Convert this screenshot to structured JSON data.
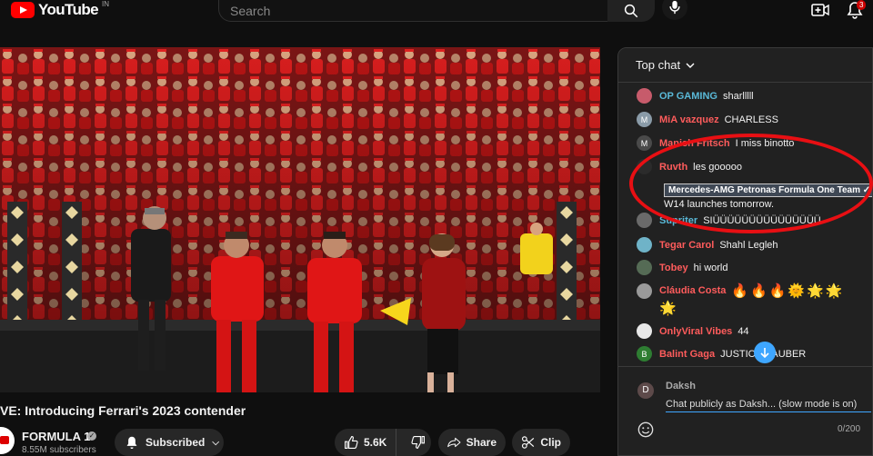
{
  "header": {
    "logo_text": "YouTube",
    "country_code": "IN",
    "search_placeholder": "Search",
    "notification_count": "3"
  },
  "video": {
    "title": "VE: Introducing Ferrari's 2023 contender"
  },
  "channel": {
    "name": "FORMULA 1",
    "subscribers": "8.55M subscribers",
    "subscribe_label": "Subscribed"
  },
  "actions": {
    "likes": "5.6K",
    "share_label": "Share",
    "clip_label": "Clip"
  },
  "chat": {
    "mode_label": "Top chat",
    "messages": [
      {
        "author": "OP GAMING",
        "text": "sharlllll",
        "author_color": "#5ab9d8",
        "avatar_color": "#c75b6b",
        "avatar_letter": ""
      },
      {
        "author": "MiA vazquez",
        "text": "CHARLESS",
        "author_color": "#ff5c5c",
        "avatar_color": "#8a9ba8",
        "avatar_letter": "M"
      },
      {
        "author": "Manish Fritsch",
        "text": "I miss binotto",
        "author_color": "#ff5c5c",
        "avatar_color": "#4a4a4a",
        "avatar_letter": "M"
      },
      {
        "author": "Ruvth",
        "text": "les gooooo",
        "author_color": "#ff5c5c",
        "avatar_color": "#2b2b2b",
        "avatar_letter": ""
      },
      {
        "author": "Supriter",
        "text": "SIÜÜÜÜÜÜÜÜÜÜÜÜÜÜÜ",
        "author_color": "#5ab9d8",
        "avatar_color": "#6a6a6a",
        "avatar_letter": ""
      },
      {
        "author": "Tegar Carol",
        "text": "Shahl Legleh",
        "author_color": "#ff5c5c",
        "avatar_color": "#6fb3c8",
        "avatar_letter": ""
      },
      {
        "author": "Tobey",
        "text": "hi world",
        "author_color": "#ff5c5c",
        "avatar_color": "#556b55",
        "avatar_letter": ""
      },
      {
        "author": "Cláudia Costa",
        "text": "🔥🔥🔥🌞🌟🌟",
        "author_color": "#ff5c5c",
        "avatar_color": "#9a9a9a",
        "avatar_letter": ""
      },
      {
        "author": "OnlyViral Vibes",
        "text": "44",
        "author_color": "#ff5c5c",
        "avatar_color": "#e8e8e8",
        "avatar_letter": ""
      },
      {
        "author": "Balint Gaga",
        "text": "JUSTICE SAUBER",
        "author_color": "#ff5c5c",
        "avatar_color": "#2e7d32",
        "avatar_letter": "B"
      }
    ],
    "cont_emoji": "🌟",
    "member_message": {
      "author": "Mercedes-AMG Petronas Formula One Team ✓",
      "text": "W14 launches tomorrow."
    },
    "input": {
      "user": "Daksh",
      "user_initial": "D",
      "placeholder": "Chat publicly as Daksh... (slow mode is on)",
      "char_count": "0/200"
    }
  }
}
